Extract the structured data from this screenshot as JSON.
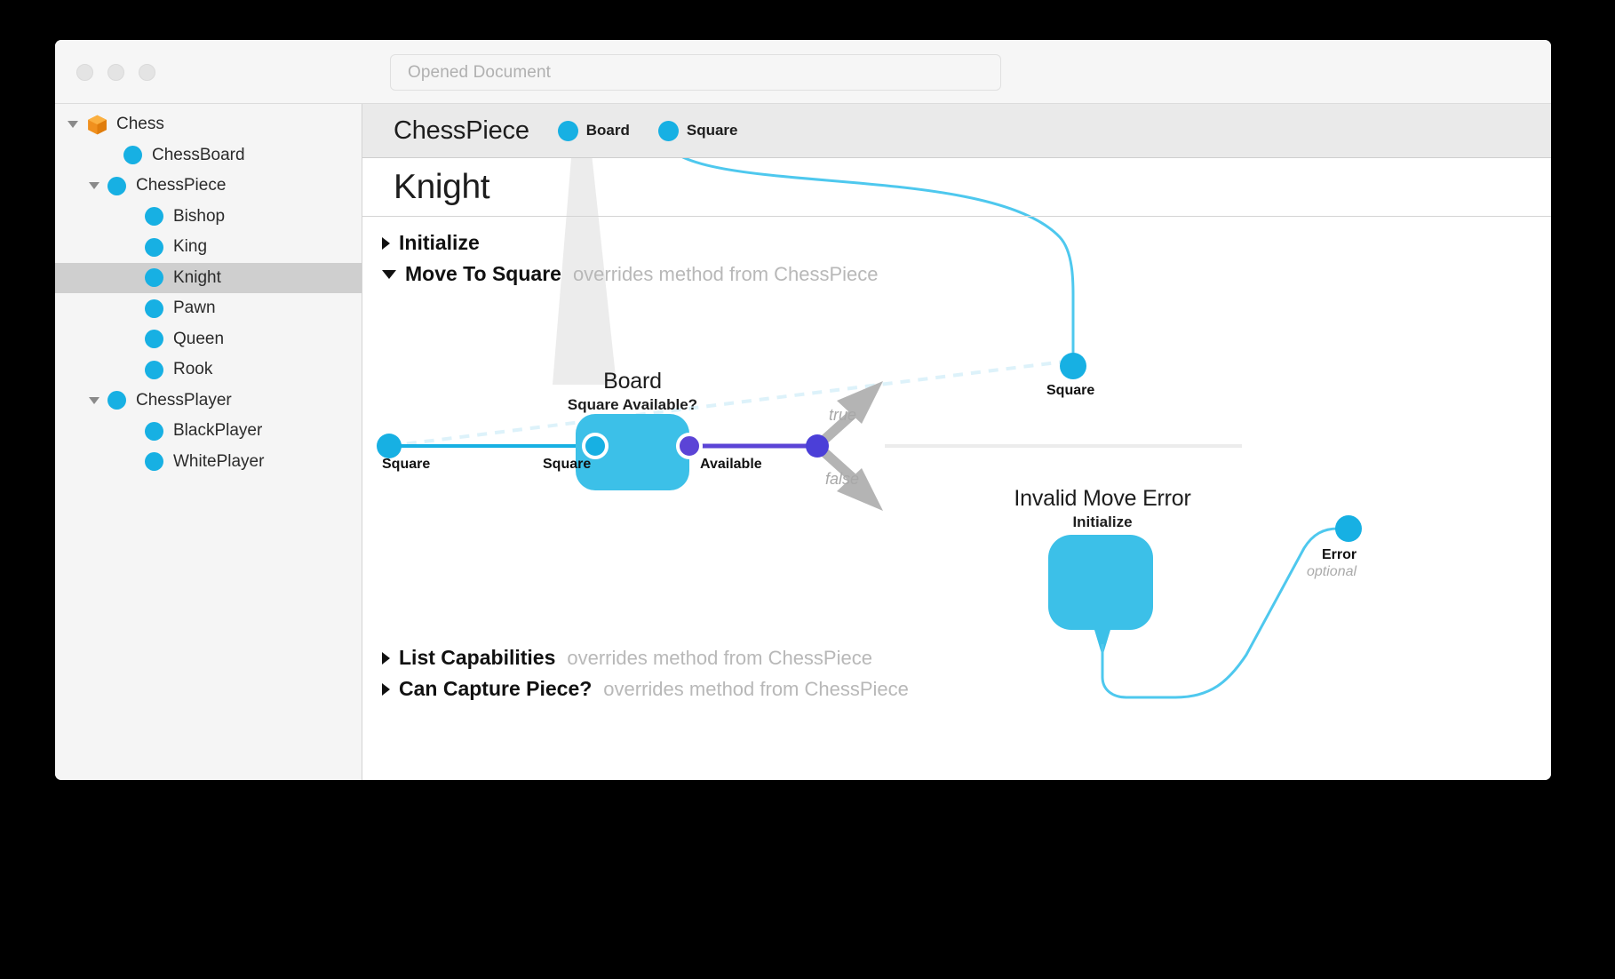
{
  "window": {
    "traffic_lights": [
      "close",
      "minimize",
      "zoom"
    ],
    "search": {
      "placeholder": "Opened Document",
      "value": ""
    }
  },
  "sidebar": {
    "items": [
      {
        "label": "Chess",
        "indent": 0,
        "icon": "cube-icon",
        "disclosure": "open",
        "selected": false
      },
      {
        "label": "ChessBoard",
        "indent": 1,
        "icon": "class-dot-icon",
        "disclosure": "none",
        "selected": false
      },
      {
        "label": "ChessPiece",
        "indent": 1,
        "icon": "class-dot-icon",
        "disclosure": "open",
        "selected": false
      },
      {
        "label": "Bishop",
        "indent": 2,
        "icon": "class-dot-icon",
        "disclosure": "none",
        "selected": false
      },
      {
        "label": "King",
        "indent": 2,
        "icon": "class-dot-icon",
        "disclosure": "none",
        "selected": false
      },
      {
        "label": "Knight",
        "indent": 2,
        "icon": "class-dot-icon",
        "disclosure": "none",
        "selected": true
      },
      {
        "label": "Pawn",
        "indent": 2,
        "icon": "class-dot-icon",
        "disclosure": "none",
        "selected": false
      },
      {
        "label": "Queen",
        "indent": 2,
        "icon": "class-dot-icon",
        "disclosure": "none",
        "selected": false
      },
      {
        "label": "Rook",
        "indent": 2,
        "icon": "class-dot-icon",
        "disclosure": "none",
        "selected": false
      },
      {
        "label": "ChessPlayer",
        "indent": 1,
        "icon": "class-dot-icon",
        "disclosure": "open",
        "selected": false
      },
      {
        "label": "BlackPlayer",
        "indent": 2,
        "icon": "class-dot-icon",
        "disclosure": "none",
        "selected": false
      },
      {
        "label": "WhitePlayer",
        "indent": 2,
        "icon": "class-dot-icon",
        "disclosure": "none",
        "selected": false
      }
    ]
  },
  "main": {
    "class_header": {
      "superclass": "ChessPiece",
      "ports": [
        {
          "label": "Board"
        },
        {
          "label": "Square"
        }
      ]
    },
    "title": "Knight",
    "methods": [
      {
        "name": "Initialize",
        "note": "",
        "expanded": false
      },
      {
        "name": "Move To Square",
        "note": "overrides method from ChessPiece",
        "expanded": true
      },
      {
        "name": "List Capabilities",
        "note": "overrides method from ChessPiece",
        "expanded": false
      },
      {
        "name": "Can Capture Piece?",
        "note": "overrides method from ChessPiece",
        "expanded": false
      }
    ],
    "graph": {
      "input_port": {
        "label": "Square"
      },
      "square_node": {
        "label": "Square"
      },
      "board_node": {
        "title": "Board",
        "subtitle": "Square Available?",
        "in_port": "Square",
        "out_port": "Available"
      },
      "branches": {
        "true_label": "true",
        "false_label": "false"
      },
      "error_node": {
        "title": "Invalid Move Error",
        "subtitle": "Initialize"
      },
      "output_port": {
        "label": "Error",
        "sub": "optional"
      }
    }
  },
  "colors": {
    "accent_cyan": "#17b0e3",
    "accent_purple": "#4b3fd8",
    "node_fill": "#3cc0e8",
    "cube_orange": "#f0901e",
    "selection_gray": "#cfcfcf",
    "muted_text": "#b8b8b8"
  }
}
